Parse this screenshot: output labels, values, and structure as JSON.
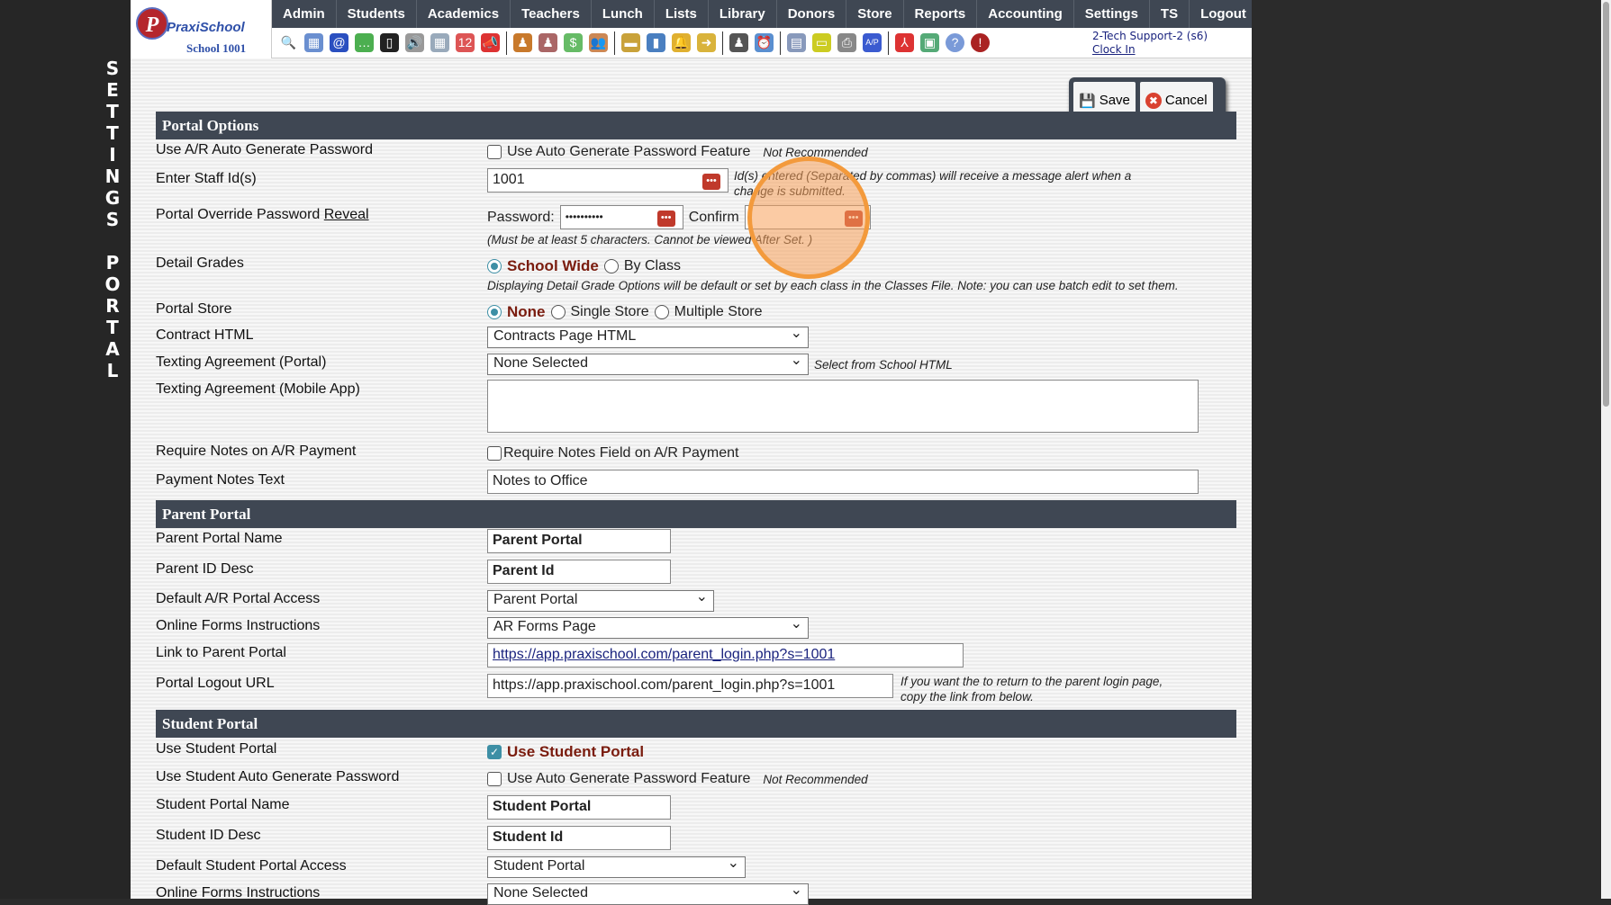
{
  "sidebar": {
    "vertical_text": [
      "S",
      "E",
      "T",
      "T",
      "I",
      "N",
      "G",
      "S",
      "",
      "P",
      "O",
      "R",
      "T",
      "A",
      "L"
    ]
  },
  "logo": {
    "name": "PraxiSchool",
    "school": "School 1001"
  },
  "nav": [
    "Admin",
    "Students",
    "Academics",
    "Teachers",
    "Lunch",
    "Lists",
    "Library",
    "Donors",
    "Store",
    "Reports",
    "Accounting",
    "Settings",
    "TS",
    "Logout"
  ],
  "toolbar_icons": [
    "search",
    "calendar-grid",
    "email-at",
    "chat",
    "mobile-phone",
    "speaker",
    "calendar",
    "calendar-date",
    "megaphone",
    "sep",
    "add-student",
    "student",
    "money",
    "parents",
    "sep",
    "lunch",
    "book",
    "bell",
    "note-arrow",
    "sep",
    "staff",
    "alarm-clock",
    "sep",
    "table",
    "card",
    "printer",
    "ap",
    "sep",
    "pdf",
    "cash-register",
    "help",
    "power"
  ],
  "user": {
    "name": "2-Tech Support-2 (s6)",
    "clock": "Clock In"
  },
  "buttons": {
    "save": "Save",
    "cancel": "Cancel"
  },
  "portal_options": {
    "title": "Portal Options",
    "auto_pw": {
      "label": "Use A/R Auto Generate Password",
      "cb": "Use Auto Generate Password Feature",
      "note": "Not Recommended"
    },
    "staff": {
      "label": "Enter Staff Id(s)",
      "value": "1001",
      "note1": "Id(s) entered (Separated by commas) will receive a message alert when a",
      "note2": "change is submitted."
    },
    "override": {
      "label": "Portal Override Password",
      "reveal": "Reveal",
      "pw_label": "Password:",
      "pw_value": "••••••••••",
      "confirm_label": "Confirm",
      "note": "(Must be at least 5 characters. Cannot be viewed After Set. )"
    },
    "grades": {
      "label": "Detail Grades",
      "opt1": "School Wide",
      "opt2": "By Class",
      "note": "Displaying Detail Grade Options will be default or set by each class in the Classes File. Note: you can use batch edit to set them."
    },
    "store": {
      "label": "Portal Store",
      "opt1": "None",
      "opt2": "Single Store",
      "opt3": "Multiple Store"
    },
    "contract": {
      "label": "Contract HTML",
      "value": "Contracts Page HTML"
    },
    "texting_portal": {
      "label": "Texting Agreement (Portal)",
      "value": "None Selected",
      "note": "Select from School HTML"
    },
    "texting_app": {
      "label": "Texting Agreement (Mobile App)",
      "value": ""
    },
    "req_notes": {
      "label": "Require Notes on A/R Payment",
      "cb": "Require Notes Field on A/R Payment"
    },
    "pay_notes": {
      "label": "Payment Notes Text",
      "value": "Notes to Office"
    }
  },
  "parent_portal": {
    "title": "Parent Portal",
    "name": {
      "label": "Parent Portal Name",
      "value": "Parent Portal"
    },
    "id_desc": {
      "label": "Parent ID Desc",
      "value": "Parent Id"
    },
    "access": {
      "label": "Default A/R Portal Access",
      "value": "Parent Portal"
    },
    "forms": {
      "label": "Online Forms Instructions",
      "value": "AR Forms Page"
    },
    "link": {
      "label": "Link to Parent Portal",
      "value": "https://app.praxischool.com/parent_login.php?s=1001"
    },
    "logout": {
      "label": "Portal Logout URL",
      "value": "https://app.praxischool.com/parent_login.php?s=1001",
      "note1": "If you want the to return to the parent login page,",
      "note2": "copy the link from below."
    }
  },
  "student_portal": {
    "title": "Student Portal",
    "use": {
      "label": "Use Student Portal",
      "cb": "Use Student Portal",
      "checked": true
    },
    "auto_pw": {
      "label": "Use Student Auto Generate Password",
      "cb": "Use Auto Generate Password Feature",
      "note": "Not Recommended"
    },
    "name": {
      "label": "Student Portal Name",
      "value": "Student Portal"
    },
    "id_desc": {
      "label": "Student ID Desc",
      "value": "Student Id"
    },
    "access": {
      "label": "Default Student Portal Access",
      "value": "Student Portal"
    },
    "forms": {
      "label": "Online Forms Instructions",
      "value": "None Selected"
    }
  },
  "colors": {
    "header": "#3f4753",
    "accent": "#3d8fa5",
    "selected_label": "#7a1c0e",
    "highlight": "#f39a3c"
  }
}
